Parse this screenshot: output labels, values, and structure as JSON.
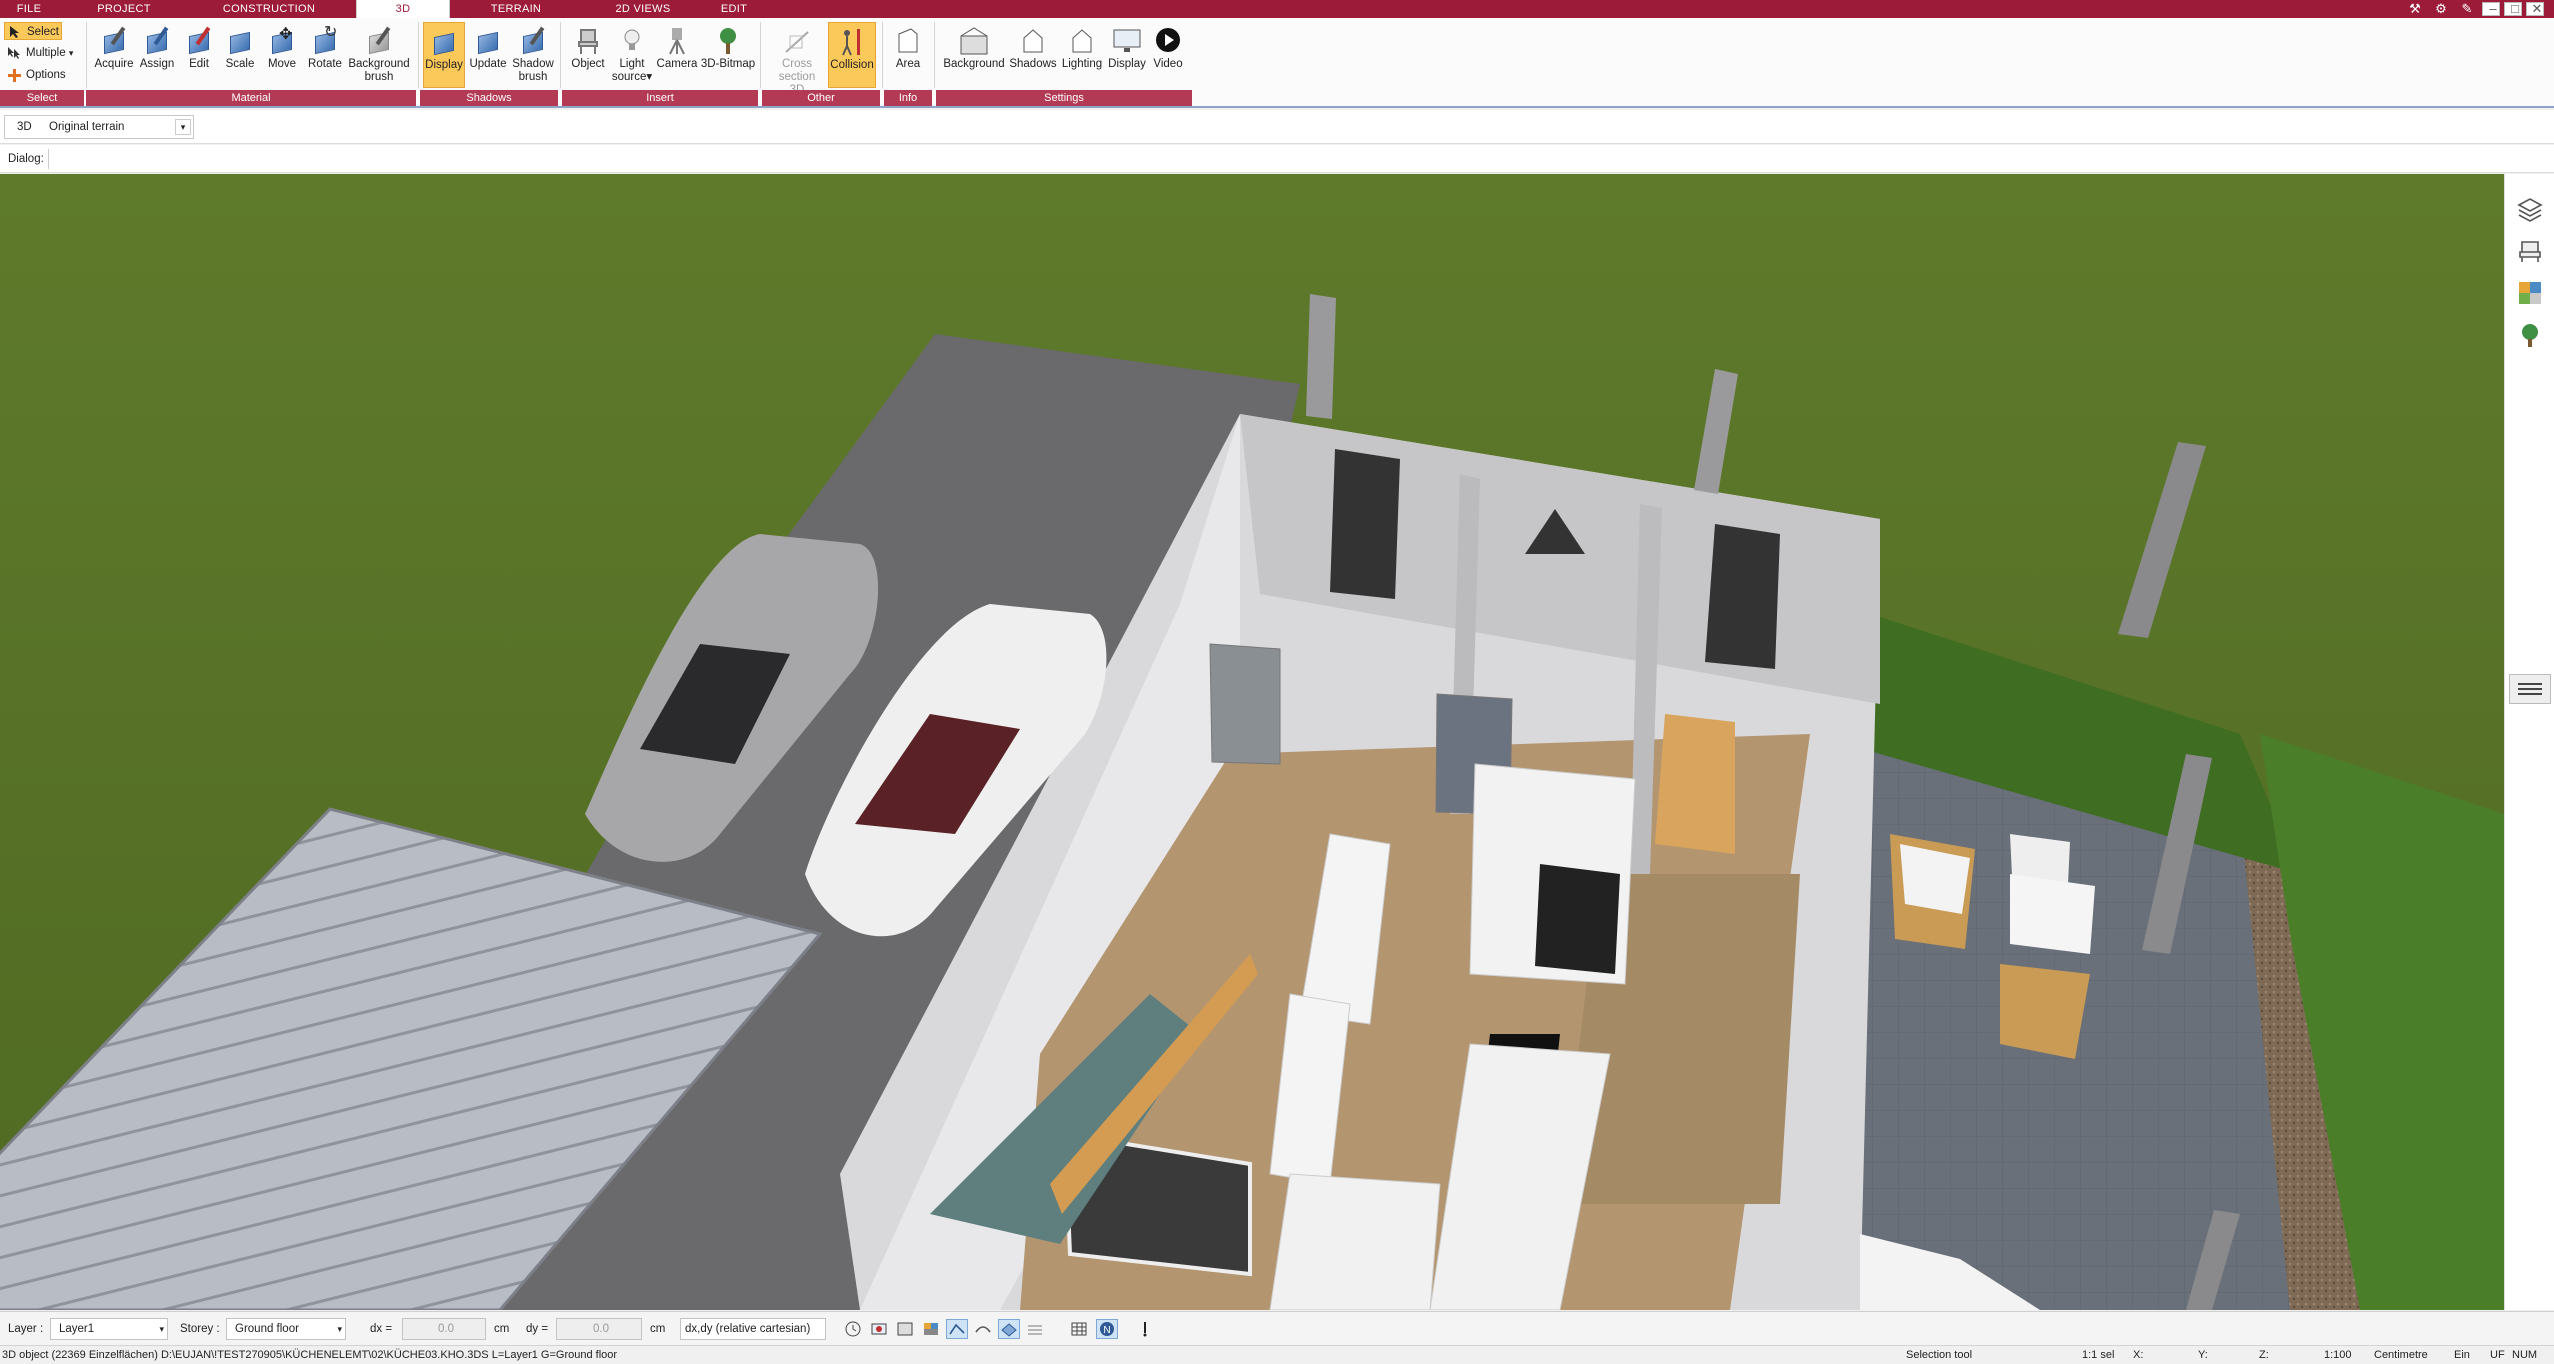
{
  "tabs": [
    "FILE",
    "PROJECT",
    "CONSTRUCTION",
    "3D",
    "TERRAIN",
    "2D VIEWS",
    "EDIT"
  ],
  "active_tab": "3D",
  "ribbon": {
    "select_group": {
      "select": "Select",
      "multiple": "Multiple",
      "options": "Options",
      "label": "Select"
    },
    "material": {
      "acquire": "Acquire",
      "assign": "Assign",
      "edit": "Edit",
      "scale": "Scale",
      "move": "Move",
      "rotate": "Rotate",
      "background_brush_1": "Background",
      "background_brush_2": "brush",
      "label": "Material"
    },
    "shadows": {
      "display": "Display",
      "update": "Update",
      "shadow_brush_1": "Shadow",
      "shadow_brush_2": "brush",
      "label": "Shadows"
    },
    "insert": {
      "object": "Object",
      "light_source_1": "Light",
      "light_source_2": "source",
      "camera": "Camera",
      "bitmap": "3D-Bitmap",
      "label": "Insert"
    },
    "other": {
      "cross_section_1": "Cross",
      "cross_section_2": "section 3D",
      "collision": "Collision",
      "label": "Other"
    },
    "info": {
      "area": "Area",
      "label": "Info"
    },
    "settings": {
      "background": "Background",
      "shadows": "Shadows",
      "lighting": "Lighting",
      "display": "Display",
      "video": "Video",
      "label": "Settings"
    }
  },
  "viewbar": {
    "mode": "3D",
    "terrain": "Original terrain"
  },
  "dialog_label": "Dialog:",
  "footer": {
    "layer_label": "Layer :",
    "layer_value": "Layer1",
    "storey_label": "Storey :",
    "storey_value": "Ground floor",
    "dx_label": "dx =",
    "dx_value": "0.0",
    "dx_unit": "cm",
    "dy_label": "dy =",
    "dy_value": "0.0",
    "dy_unit": "cm",
    "coord_mode": "dx,dy (relative cartesian)"
  },
  "status": {
    "message": "3D object (22369 Einzelflächen) D:\\EUJAN\\!TEST270905\\KÜCHENELEMT\\02\\KÜCHE03.KHO.3DS L=Layer1 G=Ground floor",
    "tool": "Selection tool",
    "sel": "1:1 sel",
    "x": "X:",
    "y": "Y:",
    "z": "Z:",
    "scale": "1:100",
    "unit": "Centimetre",
    "ein": "Ein",
    "uf": "UF",
    "num": "NUM"
  },
  "colors": {
    "accent": "#9b1b38",
    "group_label": "#b33a55",
    "highlight": "#fbc85a",
    "grass": "#5e7a2c",
    "driveway": "#6b6b6b"
  }
}
